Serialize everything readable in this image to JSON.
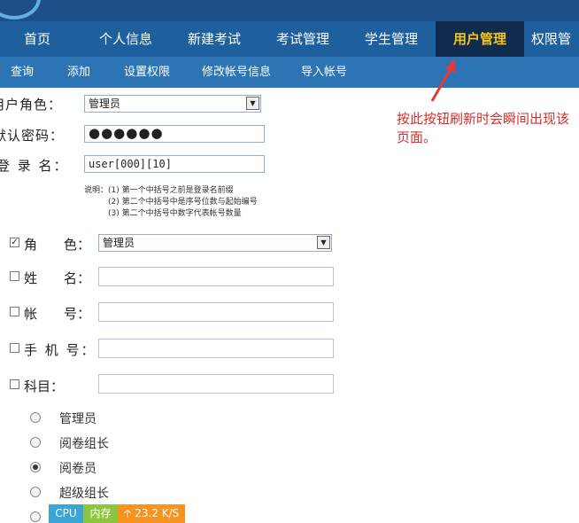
{
  "nav": {
    "items": [
      "首页",
      "个人信息",
      "新建考试",
      "考试管理",
      "学生管理",
      "用户管理",
      "权限管"
    ],
    "active": "用户管理"
  },
  "subnav": {
    "items": [
      "查询",
      "添加",
      "设置权限",
      "修改帐号信息",
      "导入帐号"
    ]
  },
  "form": {
    "role_label": "用户角色：",
    "role_value": "管理员",
    "password_label": "默认密码：",
    "password_value": "●●●●●●",
    "login_label": "登 录 名：",
    "login_value": "user[000][10]",
    "note": {
      "line1": "说明：(1) 第一个中括号之前是登录名前缀",
      "line2": "(2) 第二个中括号中是序号位数与起始编号",
      "line3": "(3) 第二个中括号中数字代表帐号数量"
    }
  },
  "filters": {
    "role_label": "角　　色：",
    "role_value": "管理员",
    "name_label": "姓　　名：",
    "account_label": "帐　　号：",
    "phone_label": "手 机 号：",
    "subject_label": "科目："
  },
  "radios": {
    "items": [
      "管理员",
      "阅卷组长",
      "阅卷员",
      "超级组长"
    ],
    "selected": "阅卷员"
  },
  "annotation": {
    "text": "按此按钮刷新时会瞬间出现该页面。"
  },
  "statusbar": {
    "cpu": "CPU",
    "mem": "内存",
    "speed": "23.2 K/S",
    "speed_icon": "up-arrow-icon"
  },
  "colors": {
    "topbar": "#1d4f88",
    "nav": "#1e5f9e",
    "nav_active_bg": "#0f2c4e",
    "nav_active_text": "#f5c518",
    "subnav": "#2c74b3",
    "annotation": "#d32f2f",
    "cpu": "#3aa6d8",
    "mem": "#8cc63f",
    "speed": "#f7931e"
  }
}
